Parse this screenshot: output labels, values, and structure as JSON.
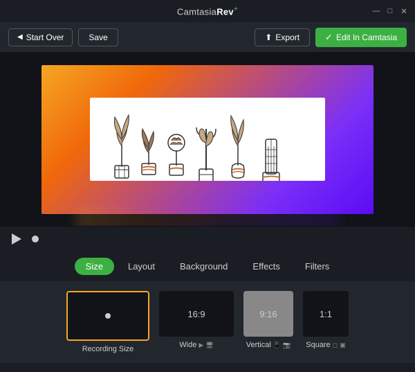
{
  "app": {
    "title": "Camtasia",
    "title_brand": "Rev",
    "title_plus": "+",
    "window_controls": [
      "—",
      "□",
      "✕"
    ]
  },
  "toolbar": {
    "start_over_label": "Start Over",
    "save_label": "Save",
    "export_label": "Export",
    "edit_camtasia_label": "Edit In Camtasia"
  },
  "tabs": [
    {
      "id": "size",
      "label": "Size",
      "active": true
    },
    {
      "id": "layout",
      "label": "Layout",
      "active": false
    },
    {
      "id": "background",
      "label": "Background",
      "active": false
    },
    {
      "id": "effects",
      "label": "Effects",
      "active": false
    },
    {
      "id": "filters",
      "label": "Filters",
      "active": false
    }
  ],
  "presets": [
    {
      "id": "recording",
      "label": "Recording Size",
      "ratio": "",
      "selected": true,
      "icons": "",
      "size": "recording"
    },
    {
      "id": "wide",
      "label": "Wide",
      "ratio": "16:9",
      "selected": false,
      "icons": "youtube monitor",
      "size": "wide"
    },
    {
      "id": "vertical",
      "label": "Vertical",
      "ratio": "9:16",
      "selected": false,
      "icons": "portrait mobile",
      "size": "vertical"
    },
    {
      "id": "square",
      "label": "Square",
      "ratio": "1:1",
      "selected": false,
      "icons": "instagram",
      "size": "square"
    }
  ],
  "colors": {
    "accent_green": "#3cb043",
    "accent_orange": "#f5a623",
    "bg_dark": "#1a1e24",
    "bg_panel": "#22272e"
  }
}
